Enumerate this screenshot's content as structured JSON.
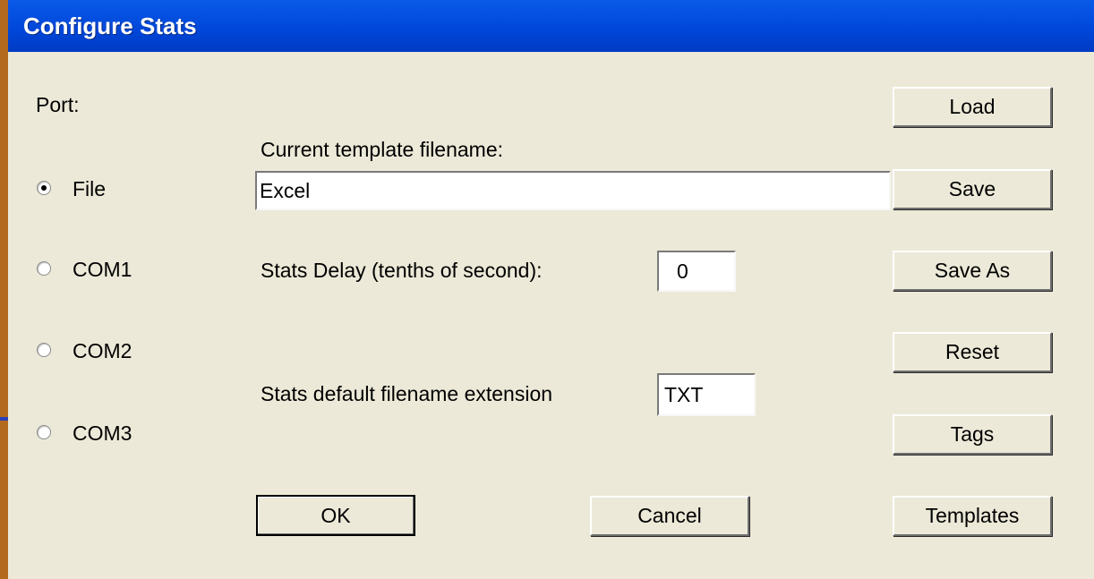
{
  "window": {
    "title": "Configure Stats"
  },
  "port": {
    "label": "Port:",
    "options": [
      {
        "label": "File",
        "selected": true
      },
      {
        "label": "COM1",
        "selected": false
      },
      {
        "label": "COM2",
        "selected": false
      },
      {
        "label": "COM3",
        "selected": false
      }
    ]
  },
  "template": {
    "label": "Current template filename:",
    "value": "Excel"
  },
  "delay": {
    "label": "Stats Delay (tenths of second):",
    "value": "0"
  },
  "extension": {
    "label": "Stats default filename extension",
    "value": "TXT"
  },
  "side_buttons": {
    "load": "Load",
    "save": "Save",
    "save_as": "Save As",
    "reset": "Reset",
    "tags": "Tags",
    "templates": "Templates"
  },
  "footer": {
    "ok": "OK",
    "cancel": "Cancel"
  },
  "colors": {
    "titlebar": "#0046d8",
    "dialog_bg": "#ece9d8",
    "frame": "#b36a1e"
  }
}
